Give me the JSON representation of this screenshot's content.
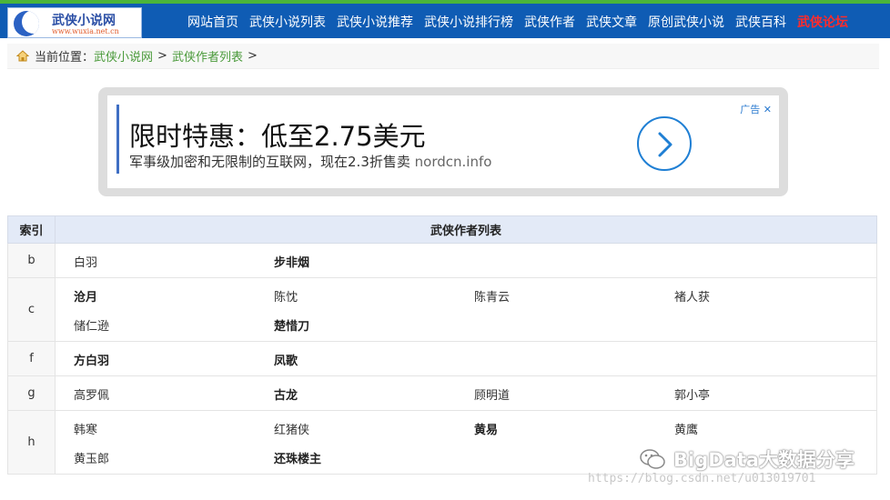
{
  "header": {
    "logo_name": "武侠小说网",
    "logo_url": "www.wuxia.net.cn",
    "nav": [
      {
        "label": "网站首页"
      },
      {
        "label": "武侠小说列表"
      },
      {
        "label": "武侠小说推荐"
      },
      {
        "label": "武侠小说排行榜"
      },
      {
        "label": "武侠作者"
      },
      {
        "label": "武侠文章"
      },
      {
        "label": "原创武侠小说"
      },
      {
        "label": "武侠百科"
      },
      {
        "label": "武侠论坛"
      }
    ]
  },
  "breadcrumb": {
    "prefix": "当前位置：",
    "items": [
      "武侠小说网",
      "武侠作者列表"
    ],
    "separator": ">"
  },
  "ad": {
    "title": "限时特惠：低至2.75美元",
    "desc": "军事级加密和无限制的互联网，现在2.3折售卖",
    "domain": "nordcn.info",
    "tag": "广告",
    "close": "✕"
  },
  "table": {
    "headers": [
      "索引",
      "武侠作者列表"
    ],
    "rows": [
      {
        "index": "b",
        "authors": [
          [
            "白羽",
            false
          ],
          [
            "步非烟",
            true
          ]
        ]
      },
      {
        "index": "c",
        "authors": [
          [
            "沧月",
            true
          ],
          [
            "陈忱",
            false
          ],
          [
            "陈青云",
            false
          ],
          [
            "褚人获",
            false
          ],
          [
            "储仁逊",
            false
          ],
          [
            "楚惜刀",
            true
          ]
        ]
      },
      {
        "index": "f",
        "authors": [
          [
            "方白羽",
            true
          ],
          [
            "凤歌",
            true
          ]
        ]
      },
      {
        "index": "g",
        "authors": [
          [
            "高罗佩",
            false
          ],
          [
            "古龙",
            true
          ],
          [
            "顾明道",
            false
          ],
          [
            "郭小亭",
            false
          ]
        ]
      },
      {
        "index": "h",
        "authors": [
          [
            "韩寒",
            false
          ],
          [
            "红猪侠",
            false
          ],
          [
            "黄易",
            true
          ],
          [
            "黄鹰",
            false
          ],
          [
            "黄玉郎",
            false
          ],
          [
            "还珠楼主",
            true
          ]
        ]
      }
    ]
  },
  "watermark": {
    "wechat": "BigData大数据分享",
    "url": "https://blog.csdn.net/u013019701"
  },
  "colors": {
    "nav_bg": "#0f5cb4",
    "top_accent": "#4bb53a",
    "link_green": "#4a9a3a",
    "forum_red": "#ff2b2b",
    "table_header_bg": "#e3eaf7",
    "ad_accent": "#1f7fd4"
  }
}
